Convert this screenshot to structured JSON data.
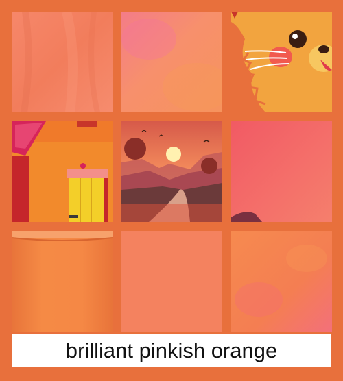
{
  "caption": "brilliant pinkish orange",
  "colors": {
    "background": "#e8703c",
    "swatch": "#f4825f",
    "caption_bg": "#ffffff",
    "caption_text": "#111111"
  },
  "tiles": [
    {
      "subject": "fabric-texture"
    },
    {
      "subject": "watercolor-wash"
    },
    {
      "subject": "cartoon-cat-face"
    },
    {
      "subject": "orange-house-yellow-door"
    },
    {
      "subject": "sunset-valley-landscape"
    },
    {
      "subject": "pink-gradient-hill"
    },
    {
      "subject": "orange-mug-closeup"
    },
    {
      "subject": "plain-swatch"
    },
    {
      "subject": "grunge-texture"
    }
  ]
}
